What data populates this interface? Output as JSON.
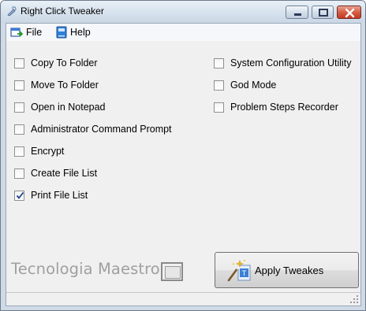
{
  "window": {
    "title": "Right Click Tweaker"
  },
  "menu": {
    "file_label": "File",
    "help_label": "Help"
  },
  "options_left": [
    {
      "label": "Copy To Folder",
      "checked": false
    },
    {
      "label": "Move To Folder",
      "checked": false
    },
    {
      "label": "Open in Notepad",
      "checked": false
    },
    {
      "label": "Administrator Command Prompt",
      "checked": false
    },
    {
      "label": "Encrypt",
      "checked": false
    },
    {
      "label": "Create File List",
      "checked": false
    },
    {
      "label": "Print File List",
      "checked": true
    }
  ],
  "options_right": [
    {
      "label": "System Configuration Utility",
      "checked": false
    },
    {
      "label": "God Mode",
      "checked": false
    },
    {
      "label": "Problem Steps Recorder",
      "checked": false
    }
  ],
  "brand": {
    "text": "Tecnologia Maestro"
  },
  "apply_button": {
    "label": "Apply Tweakes"
  },
  "colors": {
    "close_button": "#c23b22",
    "brand_text": "#a0a0a0",
    "check_mark": "#1c3f8a"
  }
}
